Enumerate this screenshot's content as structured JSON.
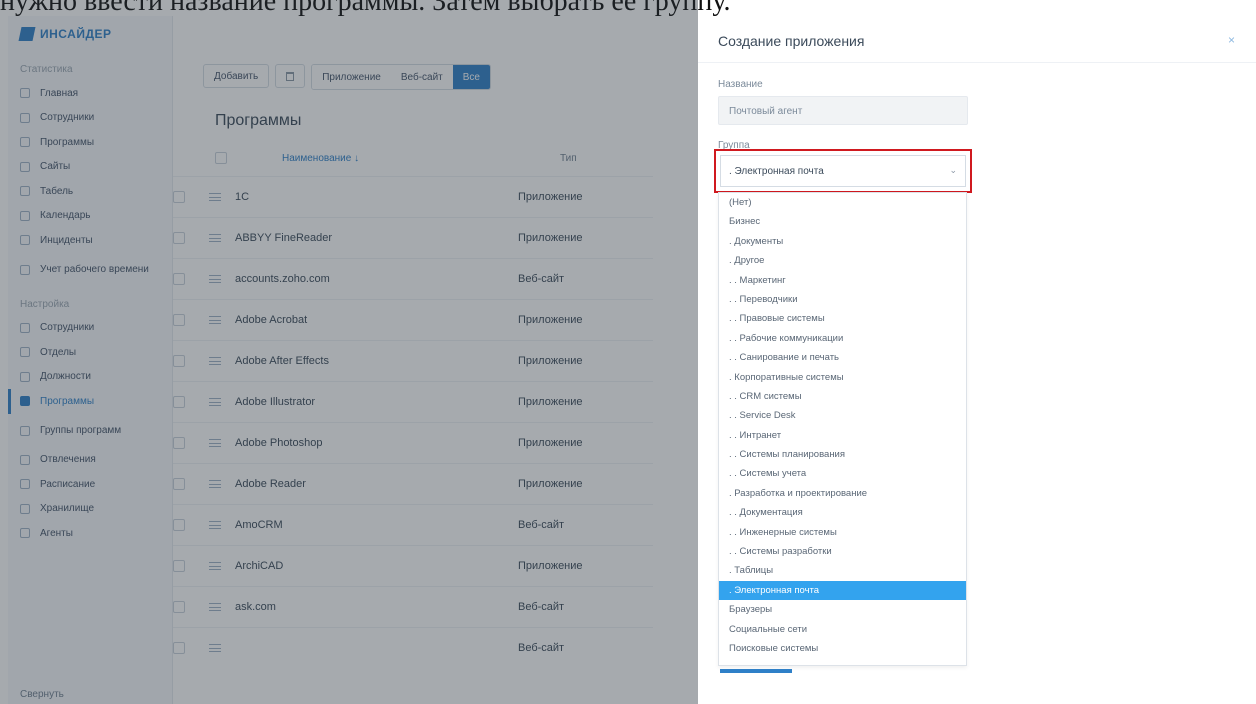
{
  "caption": "нужно ввести название программы. Затем выбрать ее группу.",
  "app": {
    "brand": "ИНСАЙДЕР",
    "sidebar": {
      "section_stats": "Статистика",
      "stats_items": [
        "Главная",
        "Сотрудники",
        "Программы",
        "Сайты",
        "Табель",
        "Календарь",
        "Инциденты",
        "Учет рабочего времени"
      ],
      "section_settings": "Настройка",
      "settings_items": [
        "Сотрудники",
        "Отделы",
        "Должности",
        "Программы",
        "Группы программ",
        "Отвлечения",
        "Расписание",
        "Хранилище",
        "Агенты"
      ],
      "active_item": "Программы",
      "collapse_label": "Свернуть"
    },
    "toolbar": {
      "add_label": "Добавить",
      "filter_app": "Приложение",
      "filter_web": "Веб-сайт",
      "filter_all": "Все"
    },
    "page_title": "Программы",
    "table": {
      "col_name": "Наименование ↓",
      "col_type": "Тип",
      "rows": [
        {
          "name": "1C",
          "type": "Приложение"
        },
        {
          "name": "ABBYY FineReader",
          "type": "Приложение"
        },
        {
          "name": "accounts.zoho.com",
          "type": "Веб-сайт"
        },
        {
          "name": "Adobe Acrobat",
          "type": "Приложение"
        },
        {
          "name": "Adobe After Effects",
          "type": "Приложение"
        },
        {
          "name": "Adobe Illustrator",
          "type": "Приложение"
        },
        {
          "name": "Adobe Photoshop",
          "type": "Приложение"
        },
        {
          "name": "Adobe Reader",
          "type": "Приложение"
        },
        {
          "name": "AmoCRM",
          "type": "Веб-сайт"
        },
        {
          "name": "ArchiCAD",
          "type": "Приложение"
        },
        {
          "name": "ask.com",
          "type": "Веб-сайт"
        },
        {
          "name": "",
          "type": "Веб-сайт"
        }
      ]
    }
  },
  "panel": {
    "title": "Создание приложения",
    "close_icon": "×",
    "name_label": "Название",
    "name_value": "Почтовый агент",
    "group_label": "Группа",
    "group_value": ". Электронная почта",
    "group_chevron": "⌄",
    "options": [
      "(Нет)",
      "Бизнес",
      ". Документы",
      ". Другое",
      ". . Маркетинг",
      ". . Переводчики",
      ". . Правовые системы",
      ". . Рабочие коммуникации",
      ". . Санирование и печать",
      ". Корпоративные системы",
      ". . CRM системы",
      ". . Service Desk",
      ". . Интранет",
      ". . Системы планирования",
      ". . Системы учета",
      ". Разработка и проектирование",
      ". . Документация",
      ". . Инженерные системы",
      ". . Системы разработки",
      ". Таблицы",
      ". Электронная почта",
      "Браузеры",
      "Социальные сети",
      "Поисковые системы"
    ],
    "selected_option": ". Электронная почта"
  },
  "colors": {
    "accent": "#2f80c8",
    "highlight": "#33a3ee",
    "focus_outline": "#d0191f"
  }
}
